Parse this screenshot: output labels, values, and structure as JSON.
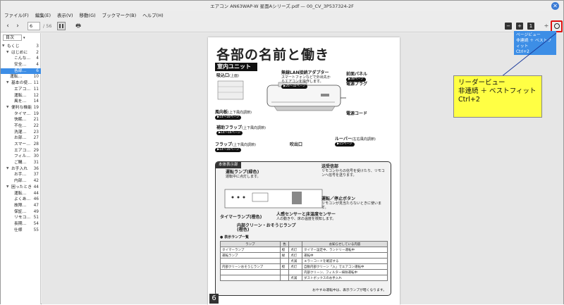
{
  "window": {
    "title": "エアコン AN63WAP-W 星面Aシリーズ.pdf — 00_CV_3P537324-2F",
    "close_glyph": "✕"
  },
  "menu": [
    "ファイル(F)",
    "編集(E)",
    "表示(V)",
    "移動(G)",
    "ブックマーク(B)",
    "ヘルプ(H)"
  ],
  "toolbar": {
    "prev_glyph": "‹",
    "next_glyph": "›",
    "page_current": "6",
    "page_total": "/ 56",
    "print_glyph": "🖶",
    "right_buttons": [
      "−",
      "+",
      "1"
    ],
    "divider_glyph": "÷"
  },
  "sidebar": {
    "select_label": "目次",
    "items": [
      {
        "label": "もくじ",
        "num": "3",
        "level": 0,
        "expand": "▼"
      },
      {
        "label": "はじめに",
        "num": "2",
        "level": 1,
        "expand": "▼"
      },
      {
        "label": "こんな…",
        "num": "4",
        "level": 2
      },
      {
        "label": "安全…",
        "num": "4",
        "level": 2
      },
      {
        "label": "各部…",
        "num": "6",
        "level": 2,
        "selected": true
      },
      {
        "label": "運転…",
        "num": "10",
        "level": 1
      },
      {
        "label": "基本の使…",
        "num": "11",
        "level": 1,
        "expand": "▼"
      },
      {
        "label": "エアコ…",
        "num": "11",
        "level": 2
      },
      {
        "label": "運転…",
        "num": "12",
        "level": 2
      },
      {
        "label": "風を…",
        "num": "14",
        "level": 2
      },
      {
        "label": "便利な機能",
        "num": "19",
        "level": 1,
        "expand": "▼"
      },
      {
        "label": "タイマ…",
        "num": "19",
        "level": 2
      },
      {
        "label": "快眠…",
        "num": "21",
        "level": 2
      },
      {
        "label": "不在…",
        "num": "22",
        "level": 2
      },
      {
        "label": "洗濯…",
        "num": "23",
        "level": 2
      },
      {
        "label": "お部…",
        "num": "27",
        "level": 2
      },
      {
        "label": "スマー…",
        "num": "28",
        "level": 2
      },
      {
        "label": "エアコ…",
        "num": "29",
        "level": 2
      },
      {
        "label": "フィル…",
        "num": "30",
        "level": 2
      },
      {
        "label": "ご購…",
        "num": "31",
        "level": 2
      },
      {
        "label": "お手入れ",
        "num": "36",
        "level": 1,
        "expand": "▼"
      },
      {
        "label": "お手…",
        "num": "37",
        "level": 2
      },
      {
        "label": "内部…",
        "num": "42",
        "level": 2
      },
      {
        "label": "困ったとき",
        "num": "44",
        "level": 1,
        "expand": "▼"
      },
      {
        "label": "運転…",
        "num": "44",
        "level": 2
      },
      {
        "label": "よくあ…",
        "num": "46",
        "level": 2
      },
      {
        "label": "故障…",
        "num": "47",
        "level": 2
      },
      {
        "label": "保証…",
        "num": "49",
        "level": 2
      },
      {
        "label": "リモコ…",
        "num": "51",
        "level": 2
      },
      {
        "label": "長期…",
        "num": "54",
        "level": 2
      },
      {
        "label": "仕様",
        "num": "55",
        "level": 2
      }
    ]
  },
  "page": {
    "title": "各部の名前と働き",
    "section1": "室内ユニット",
    "callouts": [
      {
        "name": "吸込口",
        "note": "(上面)",
        "pill": ""
      },
      {
        "name": "無線LAN接続アダプター",
        "note": "スマートフォンなどで外出先からエアコンを操作します。",
        "pill": "▶26〜32ページ"
      },
      {
        "name": "前面パネル",
        "note": "",
        "pill": "▶38ページ"
      },
      {
        "name": "電源プラグ",
        "note": "",
        "pill": ""
      },
      {
        "name": "風向板",
        "note": "(上下風向調節)",
        "pill": "▶14〜16ページ"
      },
      {
        "name": "補助フラップ",
        "note": "(上下風向調節)",
        "pill": "▶14〜16ページ"
      },
      {
        "name": "フラップ",
        "note": "(上下風向調節)",
        "pill": "▶14〜16ページ"
      },
      {
        "name": "吹出口",
        "note": "",
        "pill": ""
      },
      {
        "name": "電源コード",
        "note": "",
        "pill": ""
      },
      {
        "name": "ルーバー",
        "note": "(左右風向調節)",
        "pill": "▶15ページ"
      }
    ],
    "section2": "本体表示部",
    "panel_callouts": [
      {
        "name": "運転ランプ(緑色)",
        "note": "運転中に点灯します。"
      },
      {
        "name": "送受信部",
        "note": "リモコンからの信号を受けたり、リモコンへ信号を送ります。"
      },
      {
        "name": "運転／停止ボタン",
        "note": "リモコンが見当たらないときに使います。"
      },
      {
        "name": "タイマーランプ(橙色)",
        "note": ""
      },
      {
        "name": "人感センサーと床温度センサー",
        "note": "人の動きや、床の温度を検知します。"
      },
      {
        "name": "内部クリーン・おそうじランプ(橙色)",
        "note": ""
      }
    ],
    "lamp_table": {
      "title": "● 表示ランプ一覧",
      "headers": [
        "ランプ",
        "色",
        "",
        "お知らせしている内容"
      ],
      "rows": [
        [
          "タイマーランプ",
          "橙",
          "点灯",
          "タイマー設定中、ランドリー運転中"
        ],
        [
          "運転ランプ",
          "緑",
          "点灯",
          "運転中"
        ],
        [
          "",
          "",
          "点滅",
          "エラーコードを確認する"
        ],
        [
          "内部クリーンおそうじランプ",
          "橙",
          "点灯",
          "自動内部クリーン「入」でエアコン運転中"
        ],
        [
          "",
          "",
          "",
          "内部クリーン、フィルター掃除運転中"
        ],
        [
          "",
          "",
          "点滅",
          "ダストボックスのお手入れ"
        ]
      ],
      "footnote": "おやすみ運転中は、表示ランプが暗くなります。"
    },
    "page_number": "6"
  },
  "tooltip": {
    "lines": [
      "ページビュー",
      "非連続 ＋ ベストフィット",
      "Ctrl+2"
    ]
  },
  "annotation": {
    "lines": [
      "リーダービュー",
      "非連続 ＋ ベストフィット",
      "Ctrl+2"
    ],
    "bg": "#ffff44"
  },
  "colors": {
    "accent": "#3d8ee6",
    "highlight": "#e01010"
  }
}
